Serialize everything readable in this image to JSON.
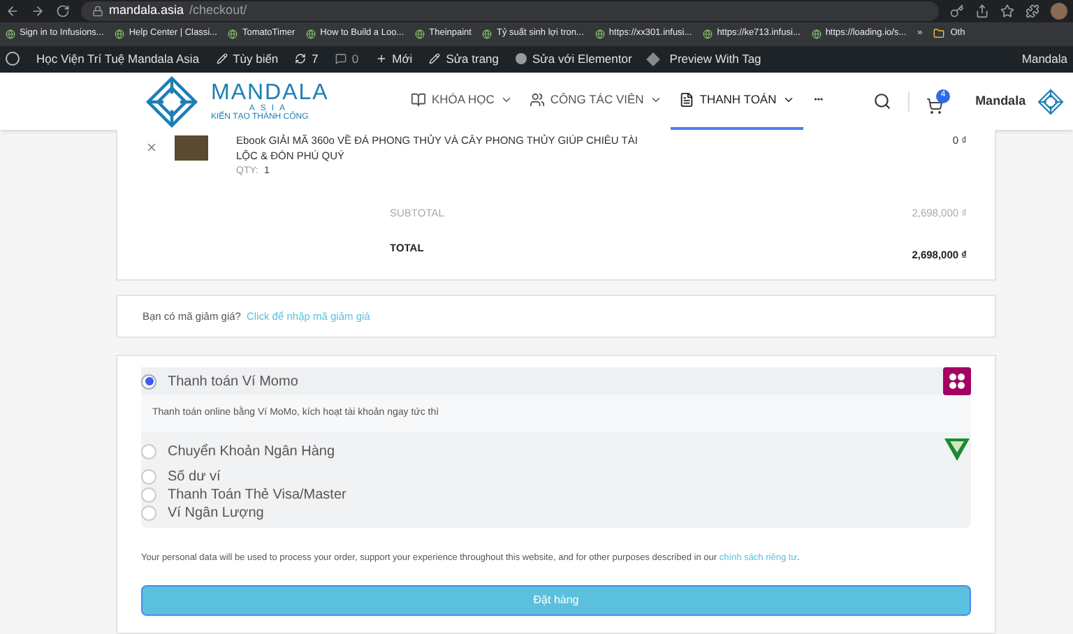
{
  "browser": {
    "url_host": "mandala.asia",
    "url_path": "/checkout/"
  },
  "bookmarks": [
    "Sign in to Infusions...",
    "Help Center | Classi...",
    "TomatoTimer",
    "How to Build a Loo...",
    "Theinpaint",
    "Tỷ suất sinh lợi tron...",
    "https://xx301.infusi...",
    "https://ke713.infusi...",
    "https://loading.io/s..."
  ],
  "bookmarks_more": "»",
  "bookmarks_other": "Oth",
  "admin_bar": {
    "site": "Học Viện Trí Tuệ Mandala Asia",
    "customize": "Tùy biến",
    "updates": "7",
    "comments": "0",
    "new": "Mới",
    "edit": "Sửa trang",
    "elementor": "Sửa với Elementor",
    "preview": "Preview With Tag",
    "user": "Mandala"
  },
  "logo": {
    "name": "MANDALA",
    "sub": "ASIA",
    "tagline": "KIẾN TẠO THÀNH CÔNG"
  },
  "nav": [
    {
      "label": "KHÓA HỌC",
      "selected": false
    },
    {
      "label": "CÔNG TÁC VIÊN",
      "selected": false
    },
    {
      "label": "THANH TOÁN",
      "selected": true
    }
  ],
  "nav_more": "•••",
  "cart_count": "4",
  "account": "Mandala",
  "order": {
    "item": {
      "title": "Ebook GIẢI MÃ 360o VỀ ĐÁ PHONG THỦY VÀ CÂY PHONG THỦY GIÚP CHIÊU TÀI LỘC & ĐÓN PHÚ QUÝ",
      "qty_label": "QTY:",
      "qty": "1",
      "price": "0 ₫"
    },
    "subtotal_label": "SUBTOTAL",
    "subtotal": "2,698,000 ₫",
    "total_label": "TOTAL",
    "total": "2,698,000 ₫"
  },
  "coupon": {
    "text": "Bạn có mã giảm giá?",
    "link": "Click để nhập mã giảm giá"
  },
  "payment_methods": [
    {
      "label": "Thanh toán Ví Momo",
      "selected": true,
      "kind": "momo",
      "description": "Thanh toán online bằng Ví MoMo, kích hoạt tài khoản ngay tức thì"
    },
    {
      "label": "Chuyển Khoản Ngân Hàng",
      "selected": false,
      "kind": "bank"
    },
    {
      "label": "Số dư ví",
      "selected": false
    },
    {
      "label": "Thanh Toán Thẻ Visa/Master",
      "selected": false
    },
    {
      "label": "Ví Ngân Lượng",
      "selected": false
    }
  ],
  "privacy": {
    "text": "Your personal data will be used to process your order, support your experience throughout this website, and for other purposes described in our",
    "link": "chính sách riêng tư",
    "end": "."
  },
  "place_order": "Đặt hàng"
}
